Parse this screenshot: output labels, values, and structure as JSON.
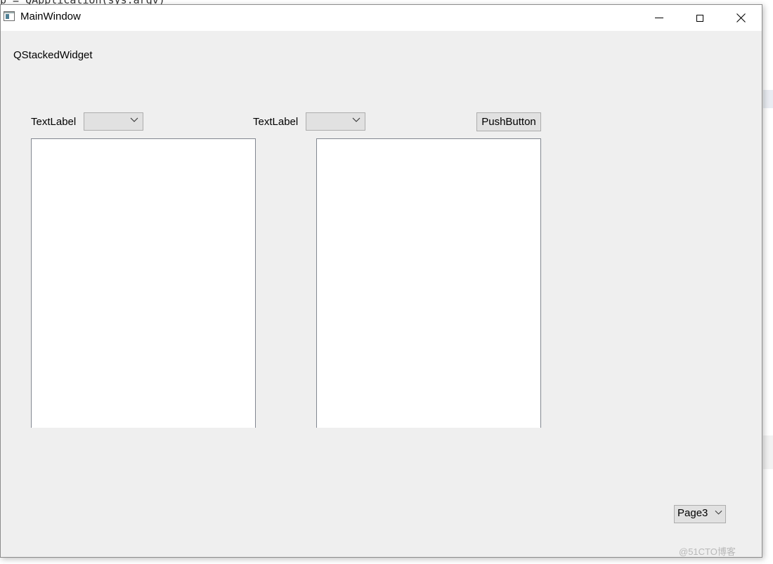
{
  "background": {
    "code_line": "p = QApplication(sys.argv)"
  },
  "window": {
    "title": "MainWindow",
    "controls": {
      "minimize": "minimize-icon",
      "maximize": "maximize-icon",
      "close": "close-icon"
    }
  },
  "content": {
    "stack_label": "QStackedWidget",
    "left_label": "TextLabel",
    "right_label": "TextLabel",
    "left_combo_value": "",
    "right_combo_value": "",
    "push_button": "PushButton",
    "page_combo_value": "Page3"
  },
  "watermark": "@51CTO博客"
}
